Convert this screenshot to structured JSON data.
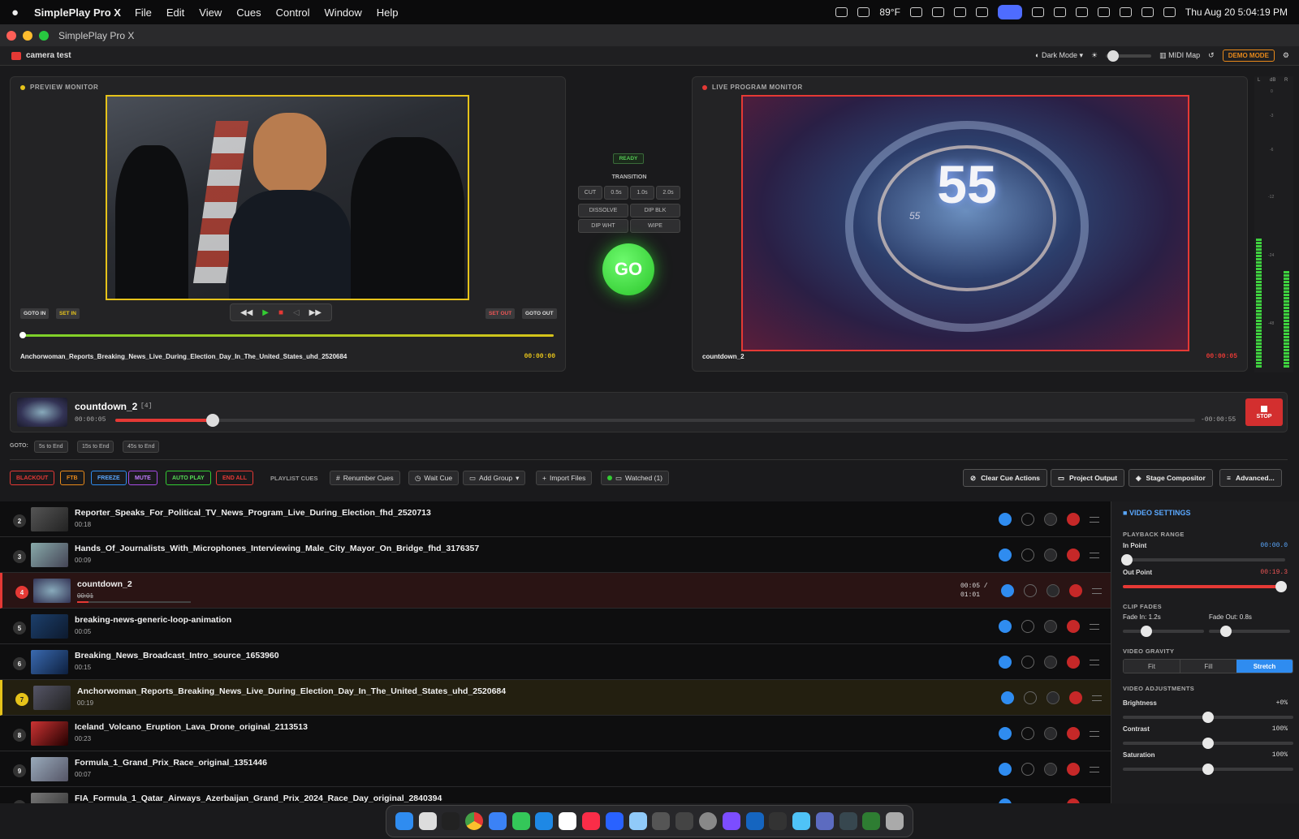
{
  "menubar": {
    "app_name": "SimplePlay Pro X",
    "menus": [
      "File",
      "Edit",
      "View",
      "Cues",
      "Control",
      "Window",
      "Help"
    ],
    "weather": "89°F",
    "datetime": "Thu Aug 20  5:04:19 PM"
  },
  "window": {
    "title": "SimplePlay Pro X"
  },
  "toolbar": {
    "project": "camera test",
    "theme": "Dark Mode",
    "midi": "MIDI Map",
    "demo": "DEMO MODE"
  },
  "preview": {
    "label": "PREVIEW MONITOR",
    "goto_in": "GOTO IN",
    "set_in": "SET IN",
    "set_out": "SET OUT",
    "goto_out": "GOTO OUT",
    "filename": "Anchorwoman_Reports_Breaking_News_Live_During_Election_Day_In_The_United_States_uhd_2520684",
    "timecode": "00:00:00",
    "scrub_progress": 0
  },
  "transition": {
    "status": "READY",
    "label": "TRANSITION",
    "cut": "CUT",
    "t1": "0.5s",
    "t2": "1.0s",
    "t3": "2.0s",
    "dissolve": "DISSOLVE",
    "dipblk": "DIP BLK",
    "dipwht": "DIP WHT",
    "wipe": "WIPE",
    "go": "GO"
  },
  "program": {
    "label": "LIVE PROGRAM MONITOR",
    "filename": "countdown_2",
    "timecode": "00:00:05",
    "countdown_big": "55",
    "countdown_small": "55"
  },
  "vu": {
    "left": "L",
    "db": "dB",
    "right": "R",
    "ticks": [
      "0",
      "-3",
      "-6",
      "-12",
      "-24",
      "-48"
    ]
  },
  "now_playing": {
    "title": "countdown_2",
    "index": "[4]",
    "elapsed": "00:00:05",
    "remaining": "-00:00:55",
    "stop": "STOP",
    "progress": 0.09
  },
  "goto": {
    "label": "GOTO:",
    "b1": "5s to End",
    "b2": "15s to End",
    "b3": "45s to End"
  },
  "actions": {
    "blackout": "BLACKOUT",
    "ftb": "FTB",
    "freeze": "FREEZE",
    "mute": "MUTE",
    "autoplay": "AUTO PLAY",
    "endall": "END ALL",
    "playlist_label": "PLAYLIST CUES",
    "renumber": "Renumber Cues",
    "wait": "Wait Cue",
    "addgroup": "Add Group",
    "import": "Import Files",
    "watched": "Watched (1)",
    "clear": "Clear Cue Actions",
    "project_output": "Project Output",
    "stage": "Stage Compositor",
    "advanced": "Advanced..."
  },
  "cues": [
    {
      "num": "2",
      "title": "Reporter_Speaks_For_Political_TV_News_Program_Live_During_Election_fhd_2520713",
      "dur": "00:18"
    },
    {
      "num": "3",
      "title": "Hands_Of_Journalists_With_Microphones_Interviewing_Male_City_Mayor_On_Bridge_fhd_3176357",
      "dur": "00:09"
    },
    {
      "num": "4",
      "title": "countdown_2",
      "dur": "00:01",
      "time": "00:05 /",
      "total": "01:01"
    },
    {
      "num": "5",
      "title": "breaking-news-generic-loop-animation",
      "dur": "00:05"
    },
    {
      "num": "6",
      "title": "Breaking_News_Broadcast_Intro_source_1653960",
      "dur": "00:15"
    },
    {
      "num": "7",
      "title": "Anchorwoman_Reports_Breaking_News_Live_During_Election_Day_In_The_United_States_uhd_2520684",
      "dur": "00:19"
    },
    {
      "num": "8",
      "title": "Iceland_Volcano_Eruption_Lava_Drone_original_2113513",
      "dur": "00:23"
    },
    {
      "num": "9",
      "title": "Formula_1_Grand_Prix_Race_original_1351446",
      "dur": "00:07"
    },
    {
      "num": "10",
      "title": "FIA_Formula_1_Qatar_Airways_Azerbaijan_Grand_Prix_2024_Race_Day_original_2840394",
      "dur": ""
    }
  ],
  "settings": {
    "title": "VIDEO SETTINGS",
    "range": "PLAYBACK RANGE",
    "in_label": "In Point",
    "in_val": "00:00.0",
    "out_label": "Out Point",
    "out_val": "00:19.3",
    "fades": "CLIP FADES",
    "fade_in": "Fade In: 1.2s",
    "fade_out": "Fade Out: 0.8s",
    "gravity": "VIDEO GRAVITY",
    "fit": "Fit",
    "fill": "Fill",
    "stretch": "Stretch",
    "adj": "VIDEO ADJUSTMENTS",
    "brightness": "Brightness",
    "brightness_val": "+0%",
    "contrast": "Contrast",
    "contrast_val": "100%",
    "saturation": "Saturation",
    "saturation_val": "100%"
  },
  "colors": {
    "accent": "#2f8cf0",
    "go": "#33cc33",
    "program": "#e53935",
    "preview": "#e6c31a"
  }
}
